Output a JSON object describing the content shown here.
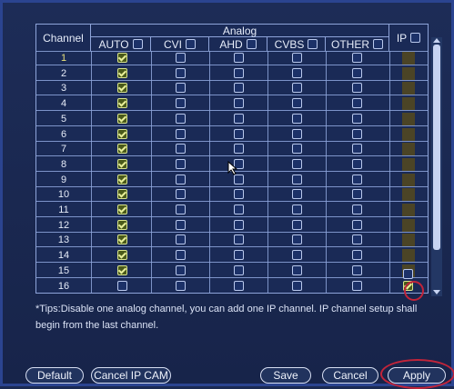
{
  "headers": {
    "channel": "Channel",
    "analog": "Analog",
    "auto": "AUTO",
    "cvi": "CVI",
    "ahd": "AHD",
    "cvbs": "CVBS",
    "other": "OTHER",
    "ip": "IP"
  },
  "rows": [
    {
      "channel": "1",
      "auto": true,
      "ip": false
    },
    {
      "channel": "2",
      "auto": true,
      "ip": false
    },
    {
      "channel": "3",
      "auto": true,
      "ip": false
    },
    {
      "channel": "4",
      "auto": true,
      "ip": false
    },
    {
      "channel": "5",
      "auto": true,
      "ip": false
    },
    {
      "channel": "6",
      "auto": true,
      "ip": false
    },
    {
      "channel": "7",
      "auto": true,
      "ip": false
    },
    {
      "channel": "8",
      "auto": true,
      "ip": false
    },
    {
      "channel": "9",
      "auto": true,
      "ip": false
    },
    {
      "channel": "10",
      "auto": true,
      "ip": false
    },
    {
      "channel": "11",
      "auto": true,
      "ip": false
    },
    {
      "channel": "12",
      "auto": true,
      "ip": false
    },
    {
      "channel": "13",
      "auto": true,
      "ip": false
    },
    {
      "channel": "14",
      "auto": true,
      "ip": false
    },
    {
      "channel": "15",
      "auto": true,
      "ip": false
    },
    {
      "channel": "16",
      "auto": false,
      "ip": true
    }
  ],
  "tips": "*Tips:Disable one analog channel, you can add one IP channel. IP channel setup shall begin from the last channel.",
  "buttons": {
    "default": "Default",
    "cancel_ip_cam": "Cancel IP CAM",
    "save": "Save",
    "cancel": "Cancel",
    "apply": "Apply"
  },
  "colors": {
    "background": "#1b2a52",
    "check": "#e8ef9a",
    "annotation": "#c2243a"
  }
}
